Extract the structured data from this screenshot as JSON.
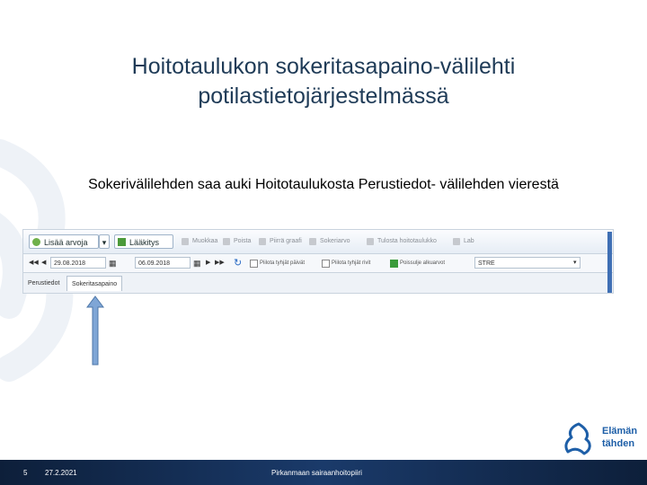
{
  "slide": {
    "title": "Hoitotaulukon sokeritasapaino-välilehti potilastietojärjestelmässä",
    "subtitle": "Sokerivälilehden saa auki Hoitotaulukosta Perustiedot- välilehden vierestä"
  },
  "screenshot": {
    "toolbar": {
      "add_value": "Lisää arvoja",
      "medication": "Lääkitys",
      "tools": [
        "Muokkaa",
        "Poista",
        "Piirrä graafi",
        "Sokeriarvo",
        "Tulosta hoitotaulukko",
        "Lab"
      ]
    },
    "nav": {
      "date_from": "29.08.2018",
      "date_to": "06.09.2018",
      "checkboxes": [
        "Piilota tyhjät päivät",
        "Piilota tyhjät rivit",
        "Poissulje alkuarvot"
      ],
      "select_value": "STRE"
    },
    "tabs": [
      "Perustiedot",
      "Sokeritasapaino"
    ]
  },
  "logo": {
    "line1": "Elämän",
    "line2": "tähden"
  },
  "footer": {
    "slide_number": "5",
    "date": "27.2.2021",
    "organization": "Pirkanmaan sairaanhoitopiiri"
  },
  "colors": {
    "title": "#1f3b57",
    "footer_bg": "#0d1f3a",
    "logo": "#1e5fa8",
    "arrow": "#7fa6d6"
  }
}
